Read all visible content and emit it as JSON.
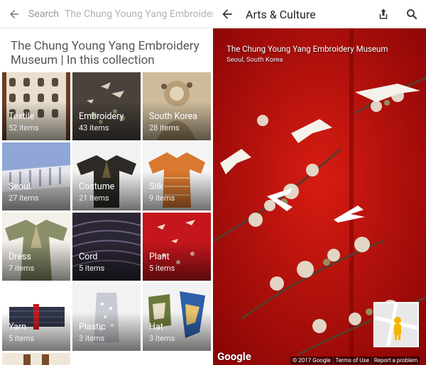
{
  "left": {
    "search_placeholder": "Search",
    "search_query": "The Chung Young Yang Embroidery M",
    "title": "The Chung Young Yang Embroidery Museum | In this collection",
    "tiles": [
      {
        "label": "Textile",
        "count": "52 items"
      },
      {
        "label": "Embroidery",
        "count": "43 items"
      },
      {
        "label": "South Korea",
        "count": "28 items"
      },
      {
        "label": "Seoul",
        "count": "27 items"
      },
      {
        "label": "Costume",
        "count": "21 items"
      },
      {
        "label": "Silk",
        "count": "9 items"
      },
      {
        "label": "Dress",
        "count": "7 items"
      },
      {
        "label": "Cord",
        "count": "5 items"
      },
      {
        "label": "Plant",
        "count": "5 items"
      },
      {
        "label": "Yarn",
        "count": "5 items"
      },
      {
        "label": "Plastic",
        "count": "3 items"
      },
      {
        "label": "Hat",
        "count": "3 items"
      }
    ]
  },
  "right": {
    "app_title": "Arts & Culture",
    "museum": "The Chung Young Yang Embroidery Museum",
    "location": "Seoul, South Korea",
    "google": "Google",
    "copyright": "© 2017 Google",
    "terms": "Terms of Use",
    "report": "Report a problem"
  }
}
